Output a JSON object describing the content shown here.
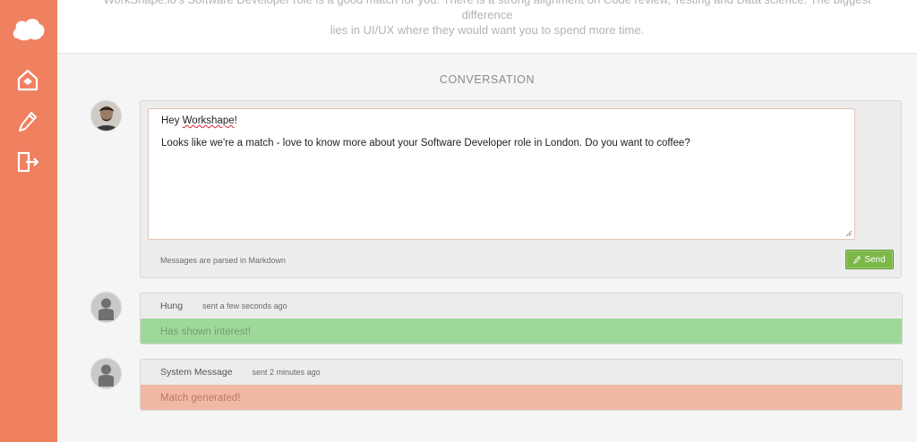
{
  "colors": {
    "sidebar": "#ef8060",
    "interest": "#9fd99a",
    "match": "#f1b9a4",
    "send": "#7bb848"
  },
  "sidebar": {
    "items": [
      {
        "name": "logo-icon"
      },
      {
        "name": "inbox-icon"
      },
      {
        "name": "pencil-icon"
      },
      {
        "name": "logout-icon"
      }
    ]
  },
  "intro": {
    "line1": "WorkShape.io's Software Developer role is a good match for you. There is a strong alignment on Code review, Testing and Data science. The biggest difference",
    "line2": "lies in UI/UX where they would want you to spend more time."
  },
  "conversation": {
    "title": "CONVERSATION"
  },
  "compose": {
    "greeting_prefix": "Hey ",
    "greeting_name": "Workshape",
    "greeting_suffix": "!",
    "body": "Looks like we're a match - love to know more about your Software Developer role in London. Do you want to coffee?",
    "markdown_hint": "Messages are parsed in Markdown",
    "send_label": "Send"
  },
  "messages": [
    {
      "author": "Hung",
      "time": "sent a few seconds ago",
      "text": "Has shown interest!",
      "status": "interest"
    },
    {
      "author": "System Message",
      "time": "sent 2 minutes ago",
      "text": "Match generated!",
      "status": "match"
    }
  ]
}
